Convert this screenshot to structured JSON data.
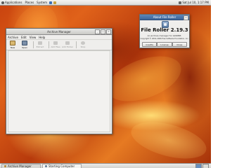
{
  "top_panel": {
    "menus": [
      "Applications",
      "Places",
      "System"
    ],
    "datetime": "Sat Jul 10,  1:17 PM"
  },
  "bottom_panel": {
    "tasks": [
      "Archive Manager",
      "Starting Computer"
    ]
  },
  "archive_manager": {
    "title": "Archive Manager",
    "menus": [
      "Archive",
      "Edit",
      "View",
      "Help"
    ],
    "toolbar": [
      "New",
      "Open",
      "Extract",
      "Add Files",
      "Add Folder",
      "Stop"
    ]
  },
  "about_dialog": {
    "title": "About File Roller",
    "app_name": "File Roller 2.19.3",
    "description": "An archive manager for GNOME.",
    "copyright": "Copyright © 2001-2006 Free Software Foundation, Inc.",
    "buttons": [
      "Credits",
      "License",
      "Close"
    ]
  }
}
